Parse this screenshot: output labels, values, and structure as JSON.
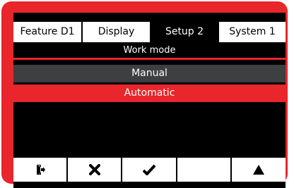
{
  "tabs": [
    {
      "label": "Feature  D1",
      "active": false
    },
    {
      "label": "Display",
      "active": false
    },
    {
      "label": "Setup 2",
      "active": true
    },
    {
      "label": "System 1",
      "active": false
    }
  ],
  "screen_title": "Work mode",
  "modes": [
    {
      "label": "Manual",
      "selected": false
    },
    {
      "label": "Automatic",
      "selected": true
    }
  ],
  "softkeys": [
    {
      "icon": "exit-icon"
    },
    {
      "icon": "close-icon"
    },
    {
      "icon": "check-icon"
    },
    {
      "icon": "blank"
    },
    {
      "icon": "arrow-up-icon"
    }
  ],
  "colors": {
    "accent": "#e8262b",
    "background": "#000000",
    "inactive_item": "#3e3f41",
    "tab": "#ffffff"
  }
}
